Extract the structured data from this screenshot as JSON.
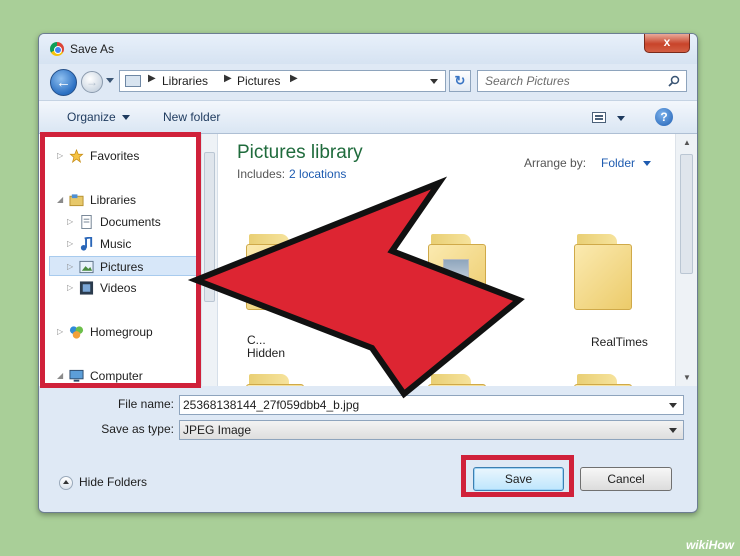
{
  "window": {
    "title": "Save As",
    "close_label": "x"
  },
  "navigation": {
    "address_crumbs": [
      "Libraries",
      "Pictures"
    ],
    "search_placeholder": "Search Pictures"
  },
  "toolbar": {
    "organize_label": "Organize",
    "new_folder_label": "New folder",
    "help_label": "?"
  },
  "nav_pane": {
    "items": [
      {
        "label": "Favorites"
      },
      {
        "label": "Libraries"
      },
      {
        "label": "Documents"
      },
      {
        "label": "Music"
      },
      {
        "label": "Pictures"
      },
      {
        "label": "Videos"
      },
      {
        "label": "Homegroup"
      },
      {
        "label": "Computer"
      }
    ]
  },
  "content": {
    "library_title": "Pictures library",
    "includes_label": "Includes:",
    "includes_link": "2 locations",
    "arrange_label": "Arrange by:",
    "arrange_value": "Folder",
    "folders": [
      {
        "label": "C... Hidden"
      },
      {
        "label": "RealTimes"
      }
    ]
  },
  "form": {
    "file_name_label": "File name:",
    "file_name_value": "25368138144_27f059dbb4_b.jpg",
    "save_as_type_label": "Save as type:",
    "save_as_type_value": "JPEG Image"
  },
  "footer": {
    "hide_folders_label": "Hide Folders",
    "save_label": "Save",
    "cancel_label": "Cancel"
  },
  "colors": {
    "highlight_red": "#d0213a",
    "background": "#a9cf98"
  },
  "watermark": {
    "wiki": "wiki",
    "how": "How"
  }
}
